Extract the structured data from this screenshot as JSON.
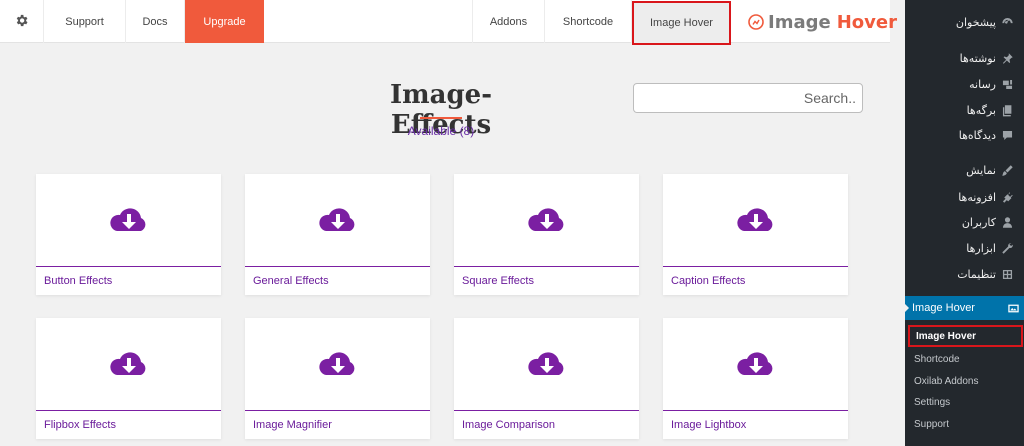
{
  "topbar": {
    "support": "Support",
    "docs": "Docs",
    "upgrade": "Upgrade",
    "addons": "Addons",
    "shortcode": "Shortcode",
    "image_hover": "Image Hover",
    "brand_part1": "Image",
    "brand_part2": "Hover"
  },
  "main": {
    "title": "Image-Effects",
    "available": "Available (8)",
    "search_placeholder": "..Search",
    "cards": [
      {
        "label": "Button Effects"
      },
      {
        "label": "General Effects"
      },
      {
        "label": "Square Effects"
      },
      {
        "label": "Caption Effects"
      },
      {
        "label": "Flipbox Effects"
      },
      {
        "label": "Image Magnifier"
      },
      {
        "label": "Image Comparison"
      },
      {
        "label": "Image Lightbox"
      }
    ]
  },
  "sidebar": {
    "items": [
      {
        "label": "پیشخوان",
        "icon": "dashboard-icon"
      },
      {
        "label": "نوشته‌ها",
        "icon": "pin-icon"
      },
      {
        "label": "رسانه",
        "icon": "media-icon"
      },
      {
        "label": "برگه‌ها",
        "icon": "pages-icon"
      },
      {
        "label": "دیدگاه‌ها",
        "icon": "comments-icon"
      },
      {
        "label": "نمایش",
        "icon": "appearance-icon"
      },
      {
        "label": "افزونه‌ها",
        "icon": "plugins-icon"
      },
      {
        "label": "کاربران",
        "icon": "users-icon"
      },
      {
        "label": "ابزارها",
        "icon": "tools-icon"
      },
      {
        "label": "تنظیمات",
        "icon": "settings-icon"
      }
    ],
    "active": {
      "label": "Image Hover",
      "icon": "image-hover-icon"
    },
    "submenu": [
      {
        "label": "Image Hover"
      },
      {
        "label": "Shortcode"
      },
      {
        "label": "Oxilab Addons"
      },
      {
        "label": "Settings"
      },
      {
        "label": "Support"
      }
    ]
  },
  "colors": {
    "accent": "#f05a3c",
    "purple": "#7b1fa2",
    "sidebar_bg": "#23282d",
    "active_bg": "#0073aa",
    "highlight_border": "#d9161b"
  }
}
